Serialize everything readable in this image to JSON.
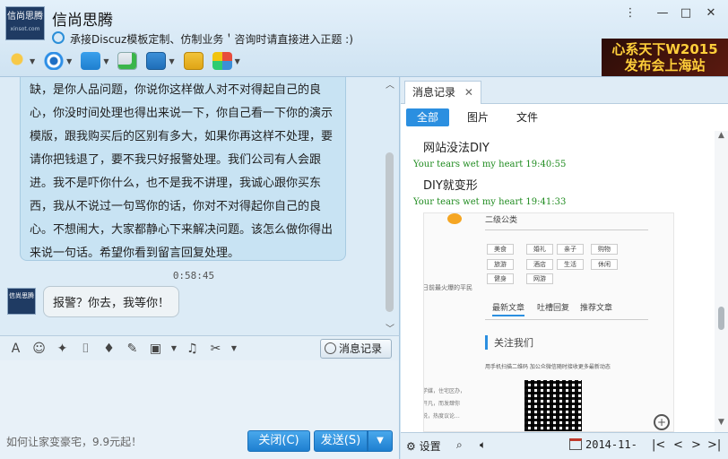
{
  "window": {
    "contact_name": "信尚思腾",
    "signature": "承接Discuz模板定制、仿制业务＇咨询时请直接进入正题 :)",
    "avatar_text": "信尚思腾",
    "avatar_sub": "xinsot.com"
  },
  "ad_banner": {
    "line1": "心系天下W2015",
    "line2": "发布会上海站"
  },
  "chat": {
    "long_message": "缺，是你人品问题，你说你这样做人对不对得起自己的良心，你没时间处理也得出来说一下，你自己看一下你的演示模版，跟我购买后的区别有多大，如果你再这样不处理，要请你把钱退了，要不我只好报警处理。我们公司有人会跟进。我不是吓你什么，也不是我不讲理，我诚心跟你买东西，我从不说过一句骂你的话，你对不对得起你自己的良心。不想闹大，大家都静心下来解决问题。该怎么做你得出来说一句话。希望你看到留言回复处理。",
    "timestamp": "0:58:45",
    "reply": "报警？你去，我等你！",
    "reply_avatar_text": "信尚思腾"
  },
  "input": {
    "history_button": "消息记录",
    "ad_text": "如何让家变豪宅，9.9元起！",
    "close_button": "关闭(C)",
    "send_button": "发送(S)"
  },
  "history": {
    "tab_label": "消息记录",
    "filters": [
      "全部",
      "图片",
      "文件"
    ],
    "messages": [
      {
        "text": "网站没法DIY",
        "meta": "Your tears wet my heart 19:40:55"
      },
      {
        "text": "DIY就变形",
        "meta": "Your tears wet my heart 19:41:33"
      }
    ],
    "embed": {
      "heading": "二级公类",
      "tags": [
        "美食",
        "婚礼",
        "亲子",
        "购物",
        "旅游",
        "酒店",
        "生活",
        "休闲",
        "健身",
        "网游"
      ],
      "side_text": "日前最火爆的平民",
      "tabs": [
        "最新文章",
        "吐槽回复",
        "推荐文章"
      ],
      "follow": "关注我们",
      "follow_sub": "用手机扫描二维码 加公众微信随时接收更多最新动态",
      "side_text2": "学媒，住宅区办，开凡，而发肆你说，热度议论..."
    },
    "bottom": {
      "settings": "设置",
      "date": "2014-11-"
    }
  }
}
